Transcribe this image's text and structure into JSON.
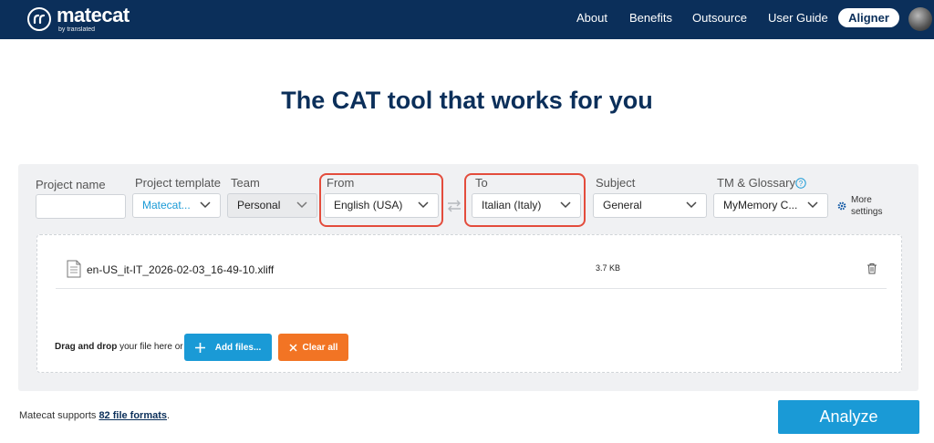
{
  "header": {
    "logo_name": "matecat",
    "logo_sub": "by translated",
    "nav": [
      "About",
      "Benefits",
      "Outsource",
      "User Guide"
    ],
    "aligner_label": "Aligner"
  },
  "hero_title": "The CAT tool that works for you",
  "form": {
    "project_name_label": "Project name",
    "project_name_value": "",
    "project_template_label": "Project template",
    "project_template_value": "Matecat...",
    "team_label": "Team",
    "team_value": "Personal",
    "from_label": "From",
    "from_value": "English (USA)",
    "to_label": "To",
    "to_value": "Italian (Italy)",
    "subject_label": "Subject",
    "subject_value": "General",
    "tm_label": "TM & Glossary",
    "tm_value": "MyMemory C...",
    "more_settings_line1": "More",
    "more_settings_line2": "settings"
  },
  "upload": {
    "file_name": "en-US_it-IT_2026-02-03_16-49-10.xliff",
    "file_size": "3.7 KB",
    "drag_bold": "Drag and drop",
    "drag_rest": " your file here or",
    "add_files_label": "Add files...",
    "clear_all_label": "Clear all"
  },
  "footer": {
    "supports_prefix": "Matecat supports ",
    "supports_link": "82 file formats",
    "supports_suffix": ".",
    "analyze_label": "Analyze"
  },
  "colors": {
    "header_bg": "#0b2f5a",
    "accent_blue": "#1a9ad6",
    "clear_orange": "#f27424",
    "highlight_red": "#e34c3c"
  }
}
